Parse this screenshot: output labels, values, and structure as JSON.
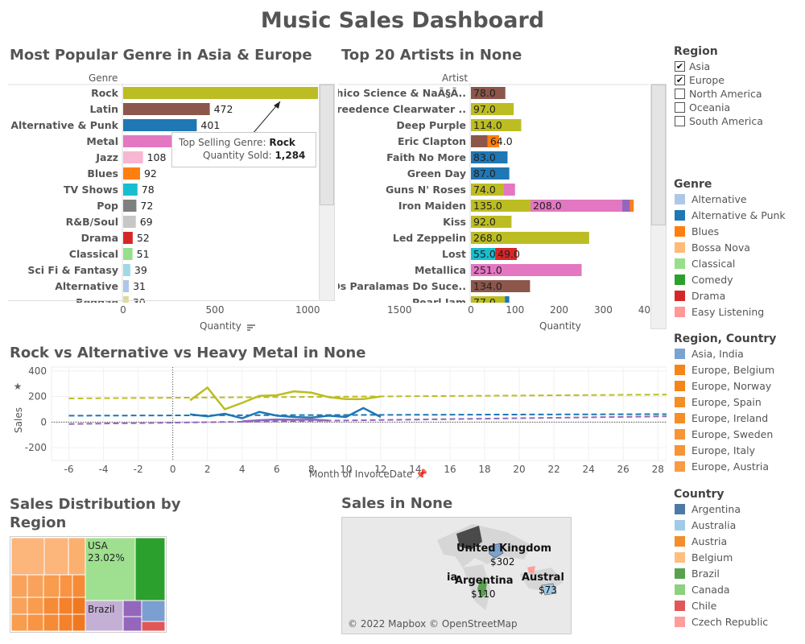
{
  "title": "Music Sales Dashboard",
  "genre_chart": {
    "title": "Most Popular Genre in Asia & Europe",
    "header": "Genre",
    "xlabel": "Quantity",
    "sort_icon": "sort-icon",
    "ticks": [
      "0",
      "500",
      "1000",
      "1500"
    ],
    "xmax": 1600,
    "rows": [
      {
        "label": "Rock",
        "value": 1284,
        "value_text": "1,284",
        "color": "#bcbd22"
      },
      {
        "label": "Latin",
        "value": 472,
        "value_text": "472",
        "color": "#8c564b"
      },
      {
        "label": "Alternative & Punk",
        "value": 401,
        "value_text": "401",
        "color": "#1f77b4"
      },
      {
        "label": "Metal",
        "value": 366,
        "value_text": "366",
        "color": "#e377c2"
      },
      {
        "label": "Jazz",
        "value": 108,
        "value_text": "108",
        "color": "#f7b6d2"
      },
      {
        "label": "Blues",
        "value": 92,
        "value_text": "92",
        "color": "#ff7f0e"
      },
      {
        "label": "TV Shows",
        "value": 78,
        "value_text": "78",
        "color": "#17becf"
      },
      {
        "label": "Pop",
        "value": 72,
        "value_text": "72",
        "color": "#7f7f7f"
      },
      {
        "label": "R&B/Soul",
        "value": 69,
        "value_text": "69",
        "color": "#c7c7c7"
      },
      {
        "label": "Drama",
        "value": 52,
        "value_text": "52",
        "color": "#d62728"
      },
      {
        "label": "Classical",
        "value": 51,
        "value_text": "51",
        "color": "#98df8a"
      },
      {
        "label": "Sci Fi & Fantasy",
        "value": 39,
        "value_text": "39",
        "color": "#9edae5"
      },
      {
        "label": "Alternative",
        "value": 31,
        "value_text": "31",
        "color": "#aec7e8"
      },
      {
        "label": "Reggae",
        "value": 30,
        "value_text": "30",
        "color": "#dbdb8d"
      }
    ],
    "tooltip": {
      "line1_label": "Top Selling Genre:",
      "line1_value": "Rock",
      "line2_label": "Quantity Sold:",
      "line2_value": "1,284"
    }
  },
  "artist_chart": {
    "title": "Top 20 Artists in None",
    "header": "Artist",
    "xlabel": "Quantity",
    "ticks": [
      "0",
      "100",
      "200",
      "300",
      "400"
    ],
    "xmax": 400,
    "rows": [
      {
        "label": "Chico Science & NaÃ§Ã..",
        "segments": [
          {
            "value": 78.0,
            "text": "78.0",
            "color": "#8c564b"
          }
        ]
      },
      {
        "label": "Creedence Clearwater ..",
        "segments": [
          {
            "value": 97.0,
            "text": "97.0",
            "color": "#bcbd22"
          }
        ]
      },
      {
        "label": "Deep Purple",
        "segments": [
          {
            "value": 114.0,
            "text": "114.0",
            "color": "#bcbd22"
          }
        ]
      },
      {
        "label": "Eric Clapton",
        "segments": [
          {
            "value": 38.0,
            "text": "",
            "color": "#8c564b"
          },
          {
            "value": 26.0,
            "text": "64.0",
            "color": "#ff7f0e"
          }
        ]
      },
      {
        "label": "Faith No More",
        "segments": [
          {
            "value": 83.0,
            "text": "83.0",
            "color": "#1f77b4"
          }
        ]
      },
      {
        "label": "Green Day",
        "segments": [
          {
            "value": 87.0,
            "text": "87.0",
            "color": "#1f77b4"
          }
        ]
      },
      {
        "label": "Guns N' Roses",
        "segments": [
          {
            "value": 74.0,
            "text": "74.0",
            "color": "#bcbd22"
          },
          {
            "value": 26.0,
            "text": "",
            "color": "#e377c2"
          }
        ]
      },
      {
        "label": "Iron Maiden",
        "segments": [
          {
            "value": 135.0,
            "text": "135.0",
            "color": "#bcbd22"
          },
          {
            "value": 208.0,
            "text": "208.0",
            "color": "#e377c2"
          },
          {
            "value": 18.0,
            "text": "",
            "color": "#9467bd"
          },
          {
            "value": 8.0,
            "text": "",
            "color": "#ff7f0e"
          }
        ]
      },
      {
        "label": "Kiss",
        "segments": [
          {
            "value": 92.0,
            "text": "92.0",
            "color": "#bcbd22"
          }
        ]
      },
      {
        "label": "Led Zeppelin",
        "segments": [
          {
            "value": 268.0,
            "text": "268.0",
            "color": "#bcbd22"
          }
        ]
      },
      {
        "label": "Lost",
        "segments": [
          {
            "value": 55.0,
            "text": "55.0",
            "color": "#17becf"
          },
          {
            "value": 49.0,
            "text": "49.0",
            "color": "#d62728"
          }
        ]
      },
      {
        "label": "Metallica",
        "segments": [
          {
            "value": 251.0,
            "text": "251.0",
            "color": "#e377c2"
          }
        ]
      },
      {
        "label": "Os Paralamas Do Suce..",
        "segments": [
          {
            "value": 134.0,
            "text": "134.0",
            "color": "#8c564b"
          }
        ]
      },
      {
        "label": "Pearl Jam",
        "segments": [
          {
            "value": 77.0,
            "text": "77.0",
            "color": "#bcbd22"
          },
          {
            "value": 10.0,
            "text": "",
            "color": "#1f77b4"
          }
        ]
      }
    ]
  },
  "line_chart": {
    "title": "Rock vs Alternative vs Heavy Metal in None",
    "ylabel": "Sales",
    "xlabel": "Month of InvoiceDate",
    "yticks": [
      400,
      200,
      0,
      -200
    ],
    "xticks": [
      -6,
      -4,
      -2,
      0,
      2,
      4,
      6,
      8,
      10,
      12,
      14,
      16,
      18,
      20,
      22,
      24,
      26,
      28
    ],
    "xrange": [
      -7,
      28.5
    ],
    "yrange": [
      -300,
      430
    ],
    "series": [
      {
        "color": "#bcbd22",
        "points": [
          [
            1,
            170
          ],
          [
            2,
            270
          ],
          [
            3,
            100
          ],
          [
            4,
            150
          ],
          [
            5,
            205
          ],
          [
            6,
            210
          ],
          [
            7,
            240
          ],
          [
            8,
            230
          ],
          [
            9,
            195
          ],
          [
            10,
            180
          ],
          [
            11,
            180
          ],
          [
            12,
            200
          ]
        ],
        "trend": [
          [
            -6,
            185
          ],
          [
            28.5,
            215
          ]
        ]
      },
      {
        "color": "#1f77b4",
        "points": [
          [
            1,
            60
          ],
          [
            2,
            45
          ],
          [
            3,
            65
          ],
          [
            4,
            30
          ],
          [
            5,
            80
          ],
          [
            6,
            50
          ],
          [
            7,
            40
          ],
          [
            8,
            35
          ],
          [
            9,
            50
          ],
          [
            10,
            40
          ],
          [
            11,
            110
          ],
          [
            12,
            40
          ]
        ],
        "trend": [
          [
            -6,
            50
          ],
          [
            28.5,
            62
          ]
        ]
      },
      {
        "color": "#9467bd",
        "points": [
          [
            4,
            5
          ],
          [
            5,
            15
          ],
          [
            6,
            20
          ],
          [
            7,
            18
          ],
          [
            8,
            20
          ],
          [
            9,
            12
          ]
        ],
        "trend": [
          [
            -6,
            -15
          ],
          [
            28.5,
            45
          ]
        ]
      }
    ]
  },
  "treemap": {
    "title_line1": "Sales Distribution by",
    "title_line2": "Region",
    "usa_label": "USA",
    "usa_pct": "23.02%",
    "brazil_label": "Brazil"
  },
  "map": {
    "title": "Sales in None",
    "uk_label": "United Kingdom",
    "uk_value": "$302",
    "argentina_label": "Argentina",
    "argentina_value": "$110",
    "australia_label": "Austral",
    "australia_value": "$73",
    "ia_label": "ia",
    "attribution": "© 2022 Mapbox © OpenStreetMap"
  },
  "legends": {
    "region_title": "Region",
    "regions": [
      {
        "label": "Asia",
        "checked": true
      },
      {
        "label": "Europe",
        "checked": true
      },
      {
        "label": "North  America",
        "checked": false
      },
      {
        "label": "Oceania",
        "checked": false
      },
      {
        "label": "South America",
        "checked": false
      }
    ],
    "genre_title": "Genre",
    "genres": [
      {
        "label": "Alternative",
        "color": "#aec7e8"
      },
      {
        "label": "Alternative & Punk",
        "color": "#1f77b4"
      },
      {
        "label": "Blues",
        "color": "#ff7f0e"
      },
      {
        "label": "Bossa Nova",
        "color": "#ffbb78"
      },
      {
        "label": "Classical",
        "color": "#98df8a"
      },
      {
        "label": "Comedy",
        "color": "#2ca02c"
      },
      {
        "label": "Drama",
        "color": "#d62728"
      },
      {
        "label": "Easy Listening",
        "color": "#ff9896"
      }
    ],
    "region_country_title": "Region, Country",
    "region_countries": [
      {
        "label": "Asia, India",
        "color": "#7ba3d0"
      },
      {
        "label": "Europe, Belgium",
        "color": "#f58518"
      },
      {
        "label": "Europe, Norway",
        "color": "#f58518"
      },
      {
        "label": "Europe, Spain",
        "color": "#f68d26"
      },
      {
        "label": "Europe, Ireland",
        "color": "#f68d26"
      },
      {
        "label": "Europe, Sweden",
        "color": "#f79434"
      },
      {
        "label": "Europe, Italy",
        "color": "#f79434"
      },
      {
        "label": "Europe, Austria",
        "color": "#f89c44"
      }
    ],
    "country_title": "Country",
    "countries": [
      {
        "label": "Argentina",
        "color": "#4e79a7"
      },
      {
        "label": "Australia",
        "color": "#a0cbe8"
      },
      {
        "label": "Austria",
        "color": "#f28e2b"
      },
      {
        "label": "Belgium",
        "color": "#ffbe7d"
      },
      {
        "label": "Brazil",
        "color": "#59a14f"
      },
      {
        "label": "Canada",
        "color": "#8cd17d"
      },
      {
        "label": "Chile",
        "color": "#e15759"
      },
      {
        "label": "Czech Republic",
        "color": "#ff9d9a"
      }
    ]
  }
}
